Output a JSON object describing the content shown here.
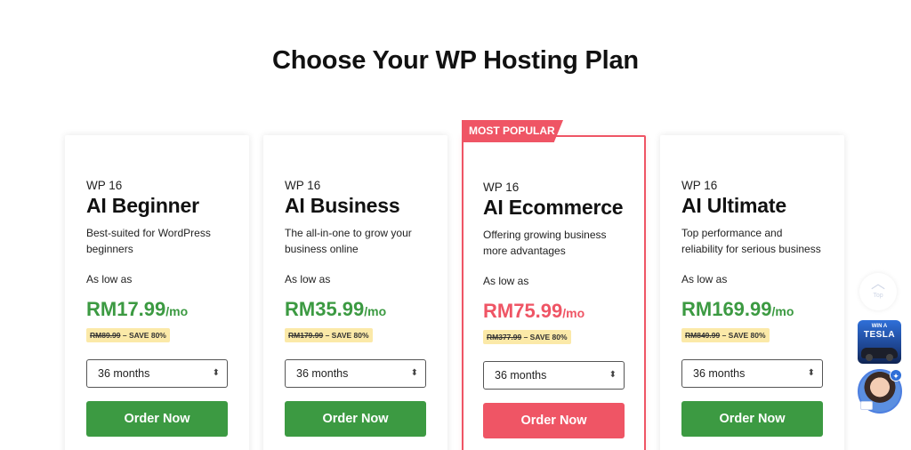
{
  "page_title": "Choose Your WP Hosting Plan",
  "colors": {
    "accent_green": "#3c9a42",
    "accent_red": "#ef5565",
    "save_tag_bg": "#fbe9a8"
  },
  "plans": [
    {
      "series": "WP 16",
      "name": "AI Beginner",
      "description": "Best-suited for WordPress beginners",
      "as_low_as": "As low as",
      "price": "RM17.99",
      "per": "/mo",
      "old_price": "RM89.99",
      "save": "– SAVE 80%",
      "term": "36 months",
      "order_label": "Order Now"
    },
    {
      "series": "WP 16",
      "name": "AI Business",
      "description": "The all-in-one to grow your business online",
      "as_low_as": "As low as",
      "price": "RM35.99",
      "per": "/mo",
      "old_price": "RM179.99",
      "save": "– SAVE 80%",
      "term": "36 months",
      "order_label": "Order Now"
    },
    {
      "badge": "MOST POPULAR",
      "series": "WP 16",
      "name": "AI Ecommerce",
      "description": "Offering growing business more advantages",
      "as_low_as": "As low as",
      "price": "RM75.99",
      "per": "/mo",
      "old_price": "RM377.99",
      "save": "– SAVE 80%",
      "term": "36 months",
      "order_label": "Order Now"
    },
    {
      "series": "WP 16",
      "name": "AI Ultimate",
      "description": "Top performance and reliability for serious business",
      "as_low_as": "As low as",
      "price": "RM169.99",
      "per": "/mo",
      "old_price": "RM849.99",
      "save": "– SAVE 80%",
      "term": "36 months",
      "order_label": "Order Now"
    }
  ],
  "floating": {
    "top_label": "Top",
    "promo_line1": "WIN A",
    "promo_line2": "TESLA",
    "icons": {
      "top": "chevron-up-icon",
      "chat": "chat-assistant-avatar",
      "spark": "sparkle-icon"
    }
  }
}
